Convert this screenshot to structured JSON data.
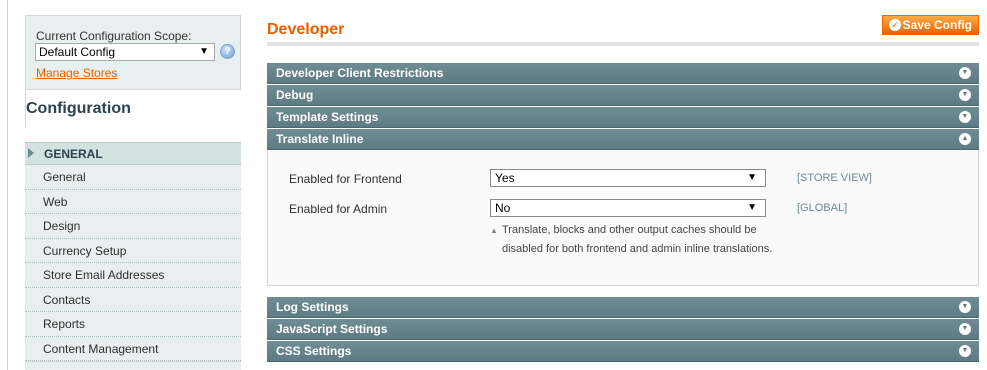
{
  "sidebar": {
    "scope_label": "Current Configuration Scope:",
    "scope_value": "Default Config",
    "manage_stores": "Manage Stores",
    "config_title": "Configuration",
    "group_label": "GENERAL",
    "items": [
      {
        "label": "General"
      },
      {
        "label": "Web"
      },
      {
        "label": "Design"
      },
      {
        "label": "Currency Setup"
      },
      {
        "label": "Store Email Addresses"
      },
      {
        "label": "Contacts"
      },
      {
        "label": "Reports"
      },
      {
        "label": "Content Management"
      }
    ]
  },
  "header": {
    "title": "Developer",
    "save_label": "Save Config"
  },
  "sections": {
    "client_restrictions": "Developer Client Restrictions",
    "debug": "Debug",
    "template_settings": "Template Settings",
    "translate_inline": "Translate Inline",
    "log_settings": "Log Settings",
    "javascript_settings": "JavaScript Settings",
    "css_settings": "CSS Settings"
  },
  "translate_inline": {
    "frontend_label": "Enabled for Frontend",
    "frontend_value": "Yes",
    "frontend_scope": "[STORE VIEW]",
    "admin_label": "Enabled for Admin",
    "admin_value": "No",
    "admin_scope": "[GLOBAL]",
    "note": "Translate, blocks and other output caches should be disabled for both frontend and admin inline translations."
  },
  "colors": {
    "accent": "#eb5e00",
    "section_bar": "#6b878e",
    "sidebar_bg": "#e7efef"
  },
  "icons": {
    "help": "help-icon",
    "save": "checkmark-icon",
    "expand": "chevron-down-icon",
    "collapse": "chevron-up-icon"
  }
}
